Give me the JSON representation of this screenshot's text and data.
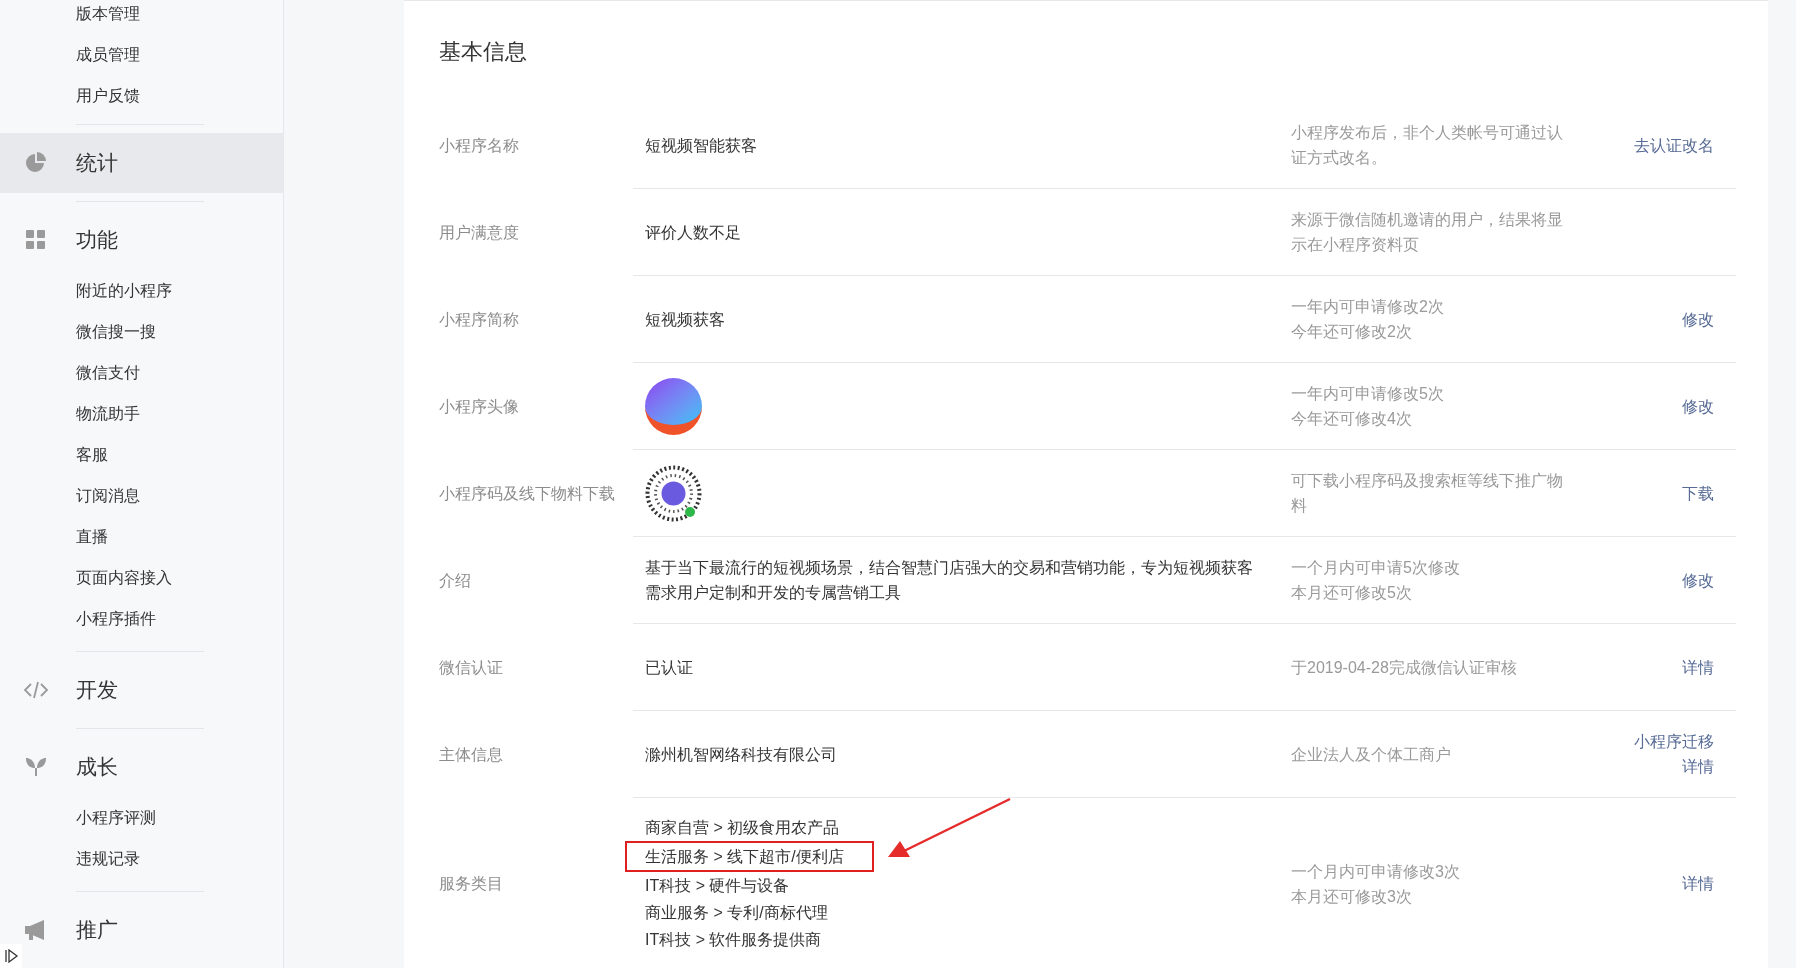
{
  "sidebar": {
    "groups": [
      {
        "children": [
          "版本管理",
          "成员管理",
          "用户反馈"
        ]
      },
      {
        "title": "统计",
        "selected": true
      },
      {
        "title": "功能",
        "selected": false,
        "children": [
          "附近的小程序",
          "微信搜一搜",
          "微信支付",
          "物流助手",
          "客服",
          "订阅消息",
          "直播",
          "页面内容接入",
          "小程序插件"
        ]
      },
      {
        "title": "开发",
        "selected": false
      },
      {
        "title": "成长",
        "selected": false,
        "children": [
          "小程序评测",
          "违规记录"
        ]
      },
      {
        "title": "推广",
        "selected": false
      }
    ]
  },
  "main": {
    "title": "基本信息",
    "rows": [
      {
        "label": "小程序名称",
        "kind": "text",
        "value": "短视频智能获客",
        "note": "小程序发布后，非个人类帐号可通过认证方式改名。",
        "actions": [
          "去认证改名"
        ]
      },
      {
        "label": "用户满意度",
        "kind": "text",
        "value": "评价人数不足",
        "note": "来源于微信随机邀请的用户，结果将显示在小程序资料页"
      },
      {
        "label": "小程序简称",
        "kind": "text",
        "value": "短视频获客",
        "note": [
          "一年内可申请修改2次",
          "今年还可修改2次"
        ],
        "actions": [
          "修改"
        ]
      },
      {
        "label": "小程序头像",
        "kind": "avatar",
        "note": [
          "一年内可申请修改5次",
          "今年还可修改4次"
        ],
        "actions": [
          "修改"
        ]
      },
      {
        "label": "小程序码及线下物料下载",
        "kind": "code",
        "note": "可下载小程序码及搜索框等线下推广物料",
        "actions": [
          "下载"
        ]
      },
      {
        "label": "介绍",
        "kind": "text",
        "value": "基于当下最流行的短视频场景，结合智慧门店强大的交易和营销功能，专为短视频获客需求用户定制和开发的专属营销工具",
        "note": [
          "一个月内可申请5次修改",
          "本月还可修改5次"
        ],
        "actions": [
          "修改"
        ]
      },
      {
        "label": "微信认证",
        "kind": "text",
        "value": "已认证",
        "note": "于2019-04-28完成微信认证审核",
        "actions": [
          "详情"
        ]
      },
      {
        "label": "主体信息",
        "kind": "text",
        "value": "滁州机智网络科技有限公司",
        "note": "企业法人及个体工商户",
        "actions": [
          "小程序迁移",
          "详情"
        ]
      },
      {
        "label": "服务类目",
        "kind": "categories",
        "categories": [
          {
            "text": "商家自营 > 初级食用农产品",
            "highlighted": false
          },
          {
            "text": "生活服务 > 线下超市/便利店",
            "highlighted": true
          },
          {
            "text": "IT科技 > 硬件与设备",
            "highlighted": false
          },
          {
            "text": "商业服务 > 专利/商标代理",
            "highlighted": false
          },
          {
            "text": "IT科技 > 软件服务提供商",
            "highlighted": false
          }
        ],
        "note": [
          "一个月内可申请修改3次",
          "本月还可修改3次"
        ],
        "actions": [
          "详情"
        ]
      }
    ]
  }
}
